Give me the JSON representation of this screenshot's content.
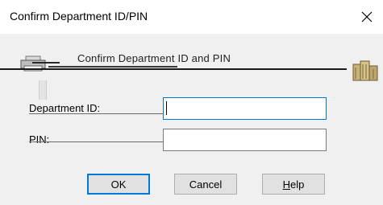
{
  "window": {
    "title": "Confirm Department ID/PIN",
    "close_glyph": "✕"
  },
  "header": {
    "text": "Confirm Department ID and PIN",
    "left_icon": "printer-icon",
    "right_icon": "building-icon"
  },
  "form": {
    "department_id": {
      "label": "Department ID:",
      "value": ""
    },
    "pin": {
      "label": "PIN:",
      "value": ""
    }
  },
  "buttons": {
    "ok": "OK",
    "cancel": "Cancel",
    "help_accel": "H",
    "help_rest": "elp"
  },
  "colors": {
    "focus_accent": "#0078d7",
    "dialog_bg": "#f0f0f0"
  }
}
